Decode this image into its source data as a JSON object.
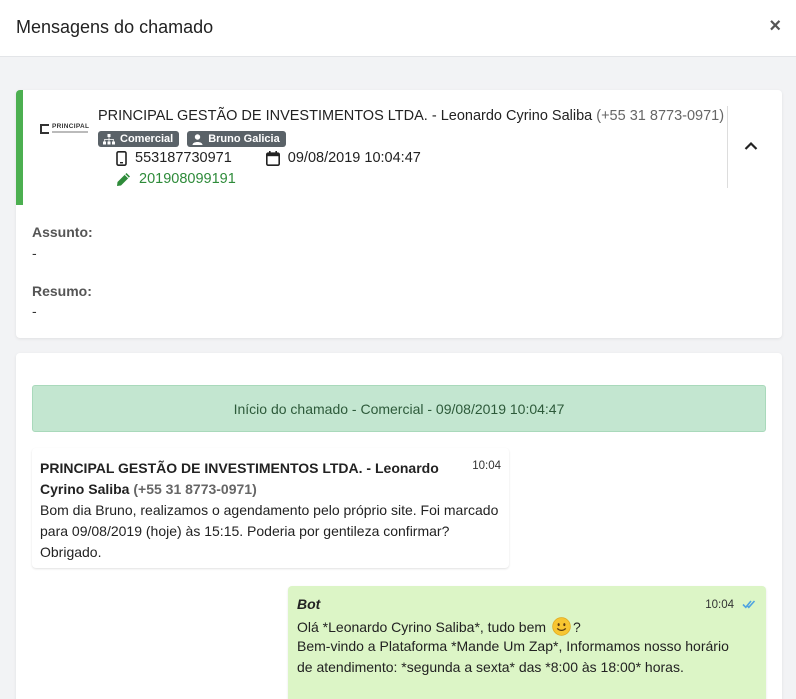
{
  "header": {
    "title": "Mensagens do chamado",
    "close_label": "×"
  },
  "ticket": {
    "logo_text": "PRINCIPAL",
    "contact_name": "PRINCIPAL GESTÃO DE INVESTIMENTOS LTDA. - Leonardo Cyrino Saliba",
    "contact_phone": "(+55 31 8773-0971)",
    "tags": [
      {
        "label": "Comercial",
        "icon": "sitemap-icon"
      },
      {
        "label": "Bruno Galicia",
        "icon": "user-icon"
      }
    ],
    "phone_number": "553187730971",
    "date": "09/08/2019 10:04:47",
    "protocol": "201908099191",
    "accent_color": "#4caf50",
    "assunto_label": "Assunto:",
    "assunto_value": "-",
    "resumo_label": "Resumo:",
    "resumo_value": "-"
  },
  "messages": {
    "start_banner": "Início do chamado - Comercial - 09/08/2019 10:04:47",
    "incoming": {
      "sender": "PRINCIPAL GESTÃO DE INVESTIMENTOS LTDA. - Leonardo Cyrino Saliba",
      "phone": "(+55 31 8773-0971)",
      "time": "10:04",
      "text": "Bom dia Bruno, realizamos o agendamento pelo próprio site. Foi marcado para 09/08/2019 (hoje) às 15:15. Poderia por gentileza confirmar? Obrigado."
    },
    "outgoing": {
      "sender": "Bot",
      "time": "10:04",
      "line1_before": "Olá *Leonardo Cyrino Saliba*, tudo bem",
      "line1_after": "?",
      "line2": "Bem-vindo a Plataforma *Mande Um Zap*, Informamos nosso horário",
      "line3": "de atendimento: *segunda a sexta* das *8:00 às 18:00* horas.",
      "bubble_color": "#dcf5c6"
    }
  }
}
